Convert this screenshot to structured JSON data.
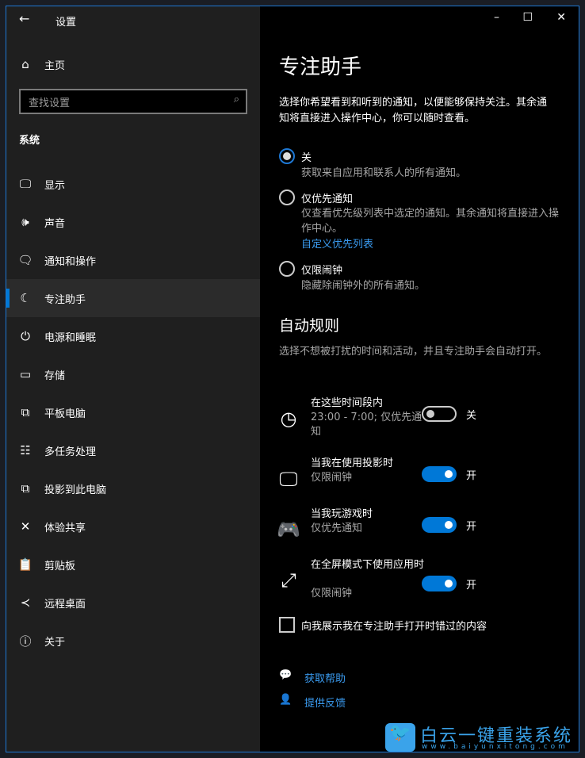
{
  "window": {
    "title": "设置",
    "minimize": "–",
    "maximize": "☐",
    "close": "✕"
  },
  "sidebar": {
    "home": "主页",
    "search_placeholder": "查找设置",
    "section": "系统",
    "items": [
      {
        "label": "显示",
        "icon": "🖵"
      },
      {
        "label": "声音",
        "icon": "🕪"
      },
      {
        "label": "通知和操作",
        "icon": "🗨"
      },
      {
        "label": "专注助手",
        "icon": "☾"
      },
      {
        "label": "电源和睡眠",
        "icon": "⏻"
      },
      {
        "label": "存储",
        "icon": "▭"
      },
      {
        "label": "平板电脑",
        "icon": "⧉"
      },
      {
        "label": "多任务处理",
        "icon": "☷"
      },
      {
        "label": "投影到此电脑",
        "icon": "⧉"
      },
      {
        "label": "体验共享",
        "icon": "✕"
      },
      {
        "label": "剪贴板",
        "icon": "📋"
      },
      {
        "label": "远程桌面",
        "icon": "≺"
      },
      {
        "label": "关于",
        "icon": "ⓘ"
      }
    ]
  },
  "main": {
    "title": "专注助手",
    "desc": "选择你希望看到和听到的通知，以便能够保持关注。其余通知将直接进入操作中心，你可以随时查看。",
    "options": [
      {
        "label": "关",
        "desc": "获取来自应用和联系人的所有通知。",
        "selected": true
      },
      {
        "label": "仅优先通知",
        "desc": "仅查看优先级列表中选定的通知。其余通知将直接进入操作中心。",
        "link": "自定义优先列表",
        "selected": false
      },
      {
        "label": "仅限闹钟",
        "desc": "隐藏除闹钟外的所有通知。",
        "selected": false
      }
    ],
    "auto_title": "自动规则",
    "auto_desc": "选择不想被打扰的时间和活动，并且专注助手会自动打开。",
    "rules": [
      {
        "title": "在这些时间段内",
        "sub": "23:00 - 7:00; 仅优先通知",
        "on": false,
        "state": "关"
      },
      {
        "title": "当我在使用投影时",
        "sub": "仅限闹钟",
        "on": true,
        "state": "开"
      },
      {
        "title": "当我玩游戏时",
        "sub": "仅优先通知",
        "on": true,
        "state": "开"
      },
      {
        "title": "在全屏模式下使用应用时",
        "sub": "仅限闹钟",
        "on": true,
        "state": "开"
      }
    ],
    "checkbox": "向我展示我在专注助手打开时错过的内容",
    "help": "获取帮助",
    "feedback": "提供反馈"
  },
  "watermark": {
    "text": "白云一键重装系统",
    "url": "www.baiyunxitong.com"
  }
}
